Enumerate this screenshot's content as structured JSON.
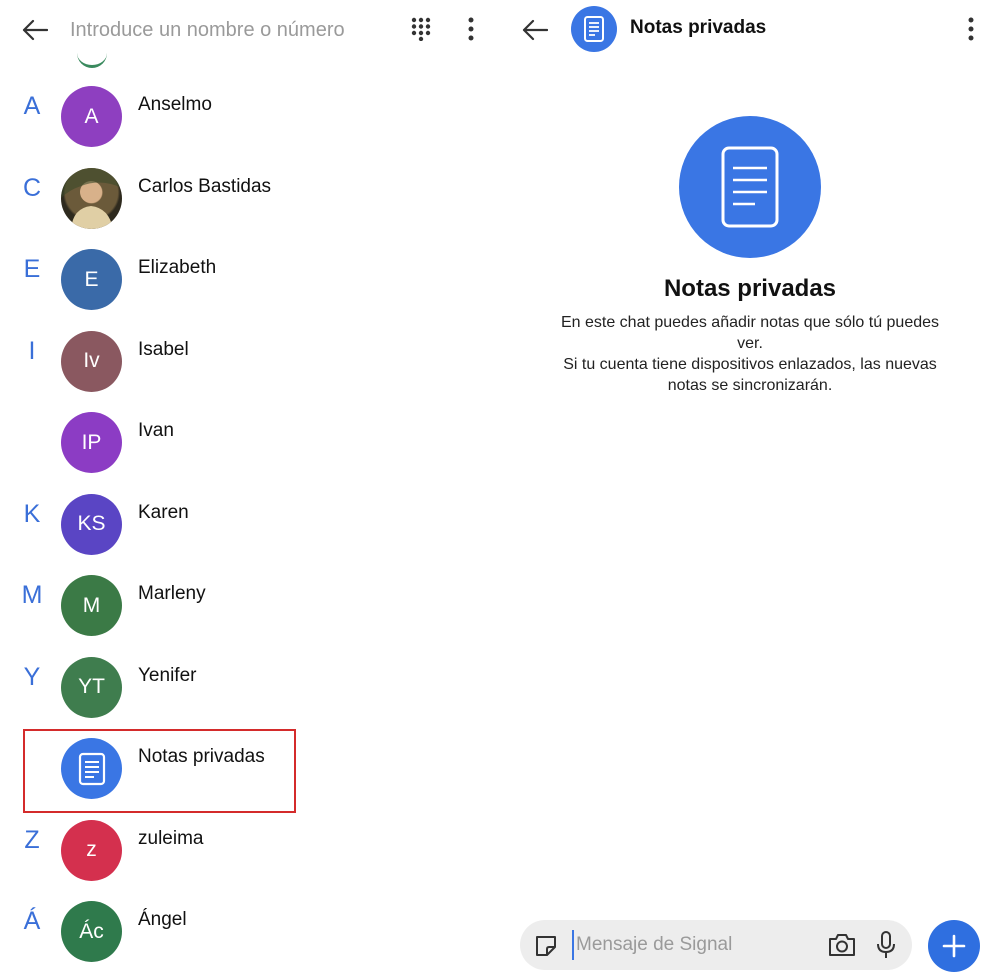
{
  "search": {
    "placeholder": "Introduce un nombre o número"
  },
  "contacts": [
    {
      "letter": "A",
      "initials": "A",
      "name": "Anselmo",
      "color": "#8e3fc0"
    },
    {
      "letter": "C",
      "initials": "",
      "name": "Carlos Bastidas",
      "color": "#6b5a3a"
    },
    {
      "letter": "E",
      "initials": "E",
      "name": "Elizabeth",
      "color": "#3a6aa8"
    },
    {
      "letter": "I",
      "initials": "Iv",
      "name": "Isabel",
      "color": "#8a5860"
    },
    {
      "letter": "",
      "initials": "IP",
      "name": "Ivan",
      "color": "#8c3cc4"
    },
    {
      "letter": "K",
      "initials": "KS",
      "name": "Karen",
      "color": "#5a45c4"
    },
    {
      "letter": "M",
      "initials": "M",
      "name": "Marleny",
      "color": "#3b7a46"
    },
    {
      "letter": "Y",
      "initials": "YT",
      "name": "Yenifer",
      "color": "#3f7d4e"
    },
    {
      "letter": "",
      "initials": "",
      "name": "Notas privadas",
      "color": "#3a76e4"
    },
    {
      "letter": "Z",
      "initials": "z",
      "name": "zuleima",
      "color": "#d4304e"
    },
    {
      "letter": "Á",
      "initials": "Ác",
      "name": "Ángel",
      "color": "#2f7a4c"
    }
  ],
  "chat": {
    "title": "Notas privadas",
    "intro_title": "Notas privadas",
    "intro_line1": "En este chat puedes añadir notas que sólo tú puedes ver.",
    "intro_line2": "Si tu cuenta tiene dispositivos enlazados, las nuevas notas se sincronizarán.",
    "composer_placeholder": "Mensaje de Signal"
  },
  "colors": {
    "accent": "#3a76e4",
    "highlight": "#d42b2b"
  },
  "icons": [
    "back-arrow-icon",
    "dialpad-icon",
    "more-vert-icon",
    "note-icon",
    "sticker-icon",
    "camera-icon",
    "microphone-icon",
    "plus-icon"
  ]
}
